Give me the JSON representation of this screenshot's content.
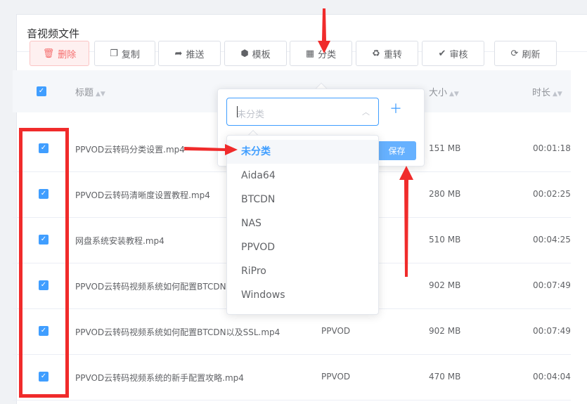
{
  "panel": {
    "title": "音视频文件"
  },
  "toolbar": {
    "delete": "删除",
    "copy": "复制",
    "push": "推送",
    "template": "模板",
    "category": "分类",
    "retranscode": "重转",
    "review": "审核",
    "refresh": "刷新"
  },
  "table": {
    "headers": {
      "title": "标题",
      "size": "大小",
      "duration": "时长"
    },
    "rows": [
      {
        "title": "PPVOD云转码分类设置.mp4",
        "category": "",
        "size": "151 MB",
        "duration": "00:01:18"
      },
      {
        "title": "PPVOD云转码清晰度设置教程.mp4",
        "category": "",
        "size": "280 MB",
        "duration": "00:02:25"
      },
      {
        "title": "网盘系统安装教程.mp4",
        "category": "",
        "size": "510 MB",
        "duration": "00:04:25"
      },
      {
        "title": "PPVOD云转码视频系统如何配置BTCDN",
        "category": "",
        "size": "902 MB",
        "duration": "00:07:49"
      },
      {
        "title": "PPVOD云转码视频系统如何配置BTCDN以及SSL.mp4",
        "category": "PPVOD",
        "size": "902 MB",
        "duration": "00:07:49"
      },
      {
        "title": "PPVOD云转码视频系统的新手配置攻略.mp4",
        "category": "PPVOD",
        "size": "470 MB",
        "duration": "00:04:04"
      }
    ]
  },
  "category_popover": {
    "placeholder": "未分类",
    "save": "保存",
    "options": [
      "未分类",
      "Aida64",
      "BTCDN",
      "NAS",
      "PPVOD",
      "RiPro",
      "Windows"
    ]
  },
  "colors": {
    "accent": "#409eff",
    "danger": "#f56c6c",
    "annotation": "#f02b2b"
  }
}
